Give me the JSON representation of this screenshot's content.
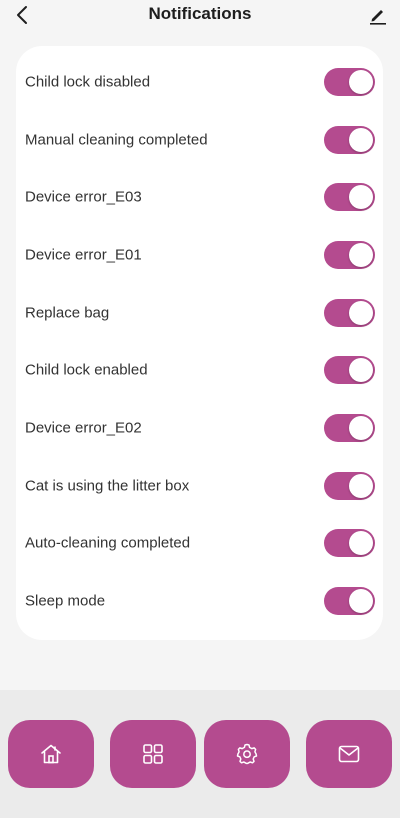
{
  "header": {
    "title": "Notifications",
    "back_icon": "chevron-left-icon",
    "edit_icon": "pencil-icon"
  },
  "colors": {
    "accent": "#b44b8f",
    "background": "#f5f5f5",
    "card": "#ffffff"
  },
  "notifications": [
    {
      "label": "Child lock disabled",
      "enabled": true
    },
    {
      "label": "Manual cleaning completed",
      "enabled": true
    },
    {
      "label": "Device error_E03",
      "enabled": true
    },
    {
      "label": "Device error_E01",
      "enabled": true
    },
    {
      "label": "Replace bag",
      "enabled": true
    },
    {
      "label": "Child lock enabled",
      "enabled": true
    },
    {
      "label": "Device error_E02",
      "enabled": true
    },
    {
      "label": "Cat is using the litter box",
      "enabled": true
    },
    {
      "label": "Auto-cleaning completed",
      "enabled": true
    },
    {
      "label": "Sleep mode",
      "enabled": true
    }
  ],
  "bottom_nav": [
    {
      "icon": "home-icon"
    },
    {
      "icon": "grid-icon"
    },
    {
      "icon": "gear-icon"
    },
    {
      "icon": "mail-icon"
    }
  ]
}
